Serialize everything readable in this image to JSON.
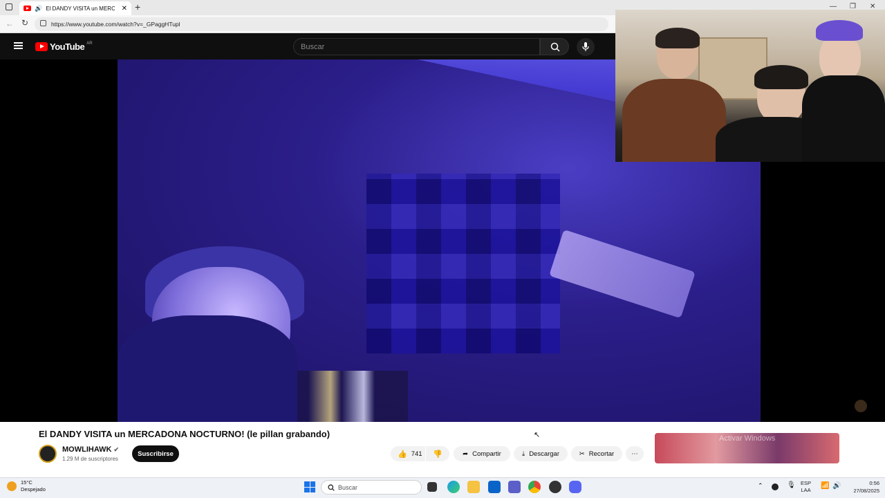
{
  "browser": {
    "tab_title": "El DANDY VISITA un MERCA",
    "url": "https://www.youtube.com/watch?v=_GPaggHTupl"
  },
  "youtube": {
    "logo_text": "YouTube",
    "region": "AR",
    "search_placeholder": "Buscar"
  },
  "video": {
    "title": "El DANDY VISITA un MERCADONA NOCTURNO! (le pillan grabando)",
    "channel": "MOWLIHAWK",
    "subscribers": "1.29 M de suscriptores",
    "subscribe_label": "Suscribirse",
    "likes": "741",
    "share_label": "Compartir",
    "download_label": "Descargar",
    "clip_label": "Recortar"
  },
  "sidebar_ad": {
    "watermark_line1": "Activar Windows"
  },
  "taskbar": {
    "weather_temp": "15°C",
    "weather_desc": "Despejado",
    "search_label": "Buscar",
    "lang_top": "ESP",
    "lang_bottom": "LAA",
    "time": "0:56",
    "date": "27/08/2025"
  },
  "colors": {
    "yt_red": "#ff0000",
    "header_dark": "#0f0f0f",
    "video_purple": "#3a2ca8"
  }
}
